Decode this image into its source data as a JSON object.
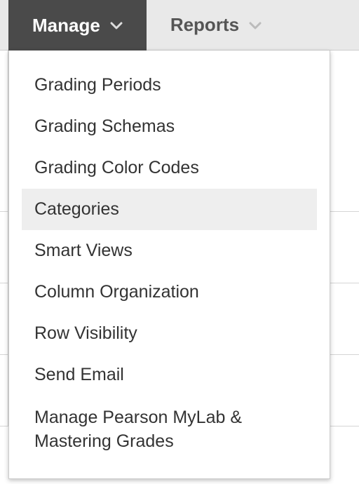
{
  "tabs": {
    "manage": {
      "label": "Manage"
    },
    "reports": {
      "label": "Reports"
    }
  },
  "dropdown": {
    "items": [
      {
        "label": "Grading Periods"
      },
      {
        "label": "Grading Schemas"
      },
      {
        "label": "Grading Color Codes"
      },
      {
        "label": "Categories",
        "highlighted": true
      },
      {
        "label": "Smart Views"
      },
      {
        "label": "Column Organization"
      },
      {
        "label": "Row Visibility"
      },
      {
        "label": "Send Email"
      },
      {
        "label": "Manage Pearson MyLab & Mastering Grades"
      }
    ]
  }
}
